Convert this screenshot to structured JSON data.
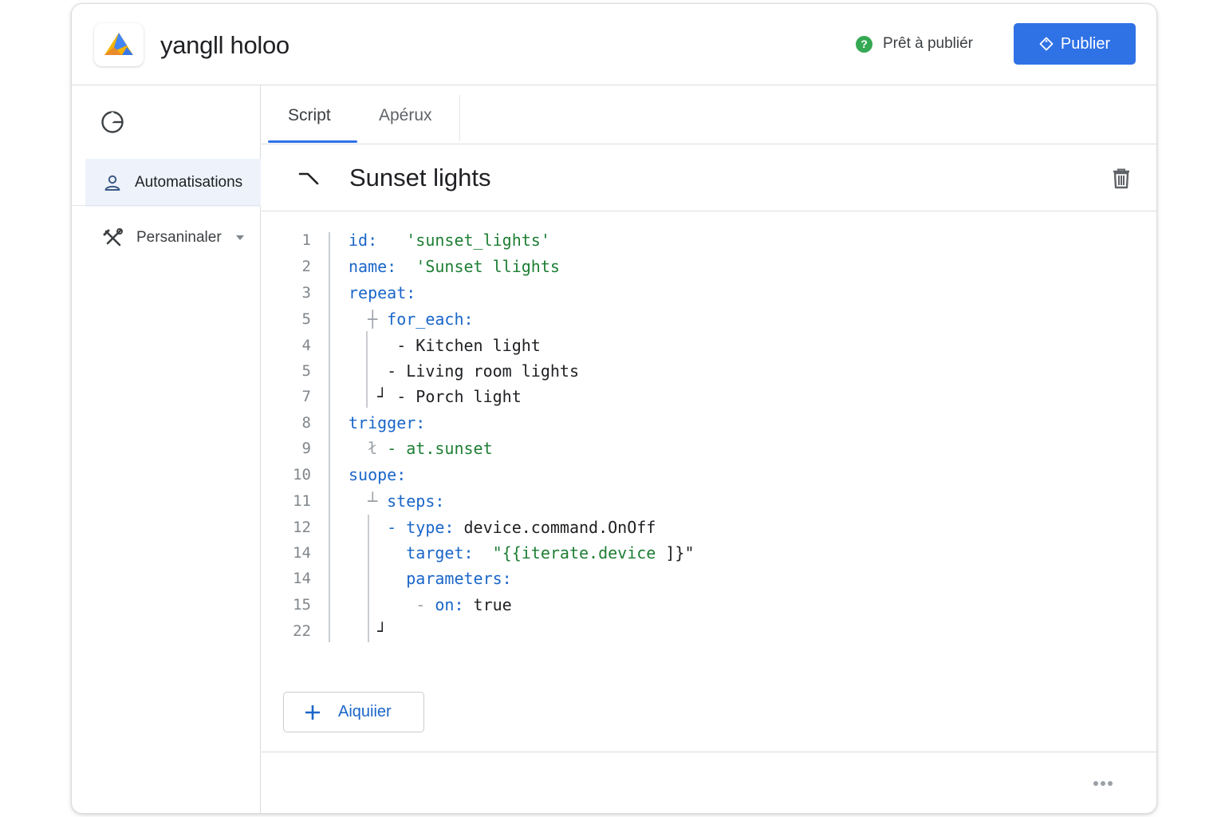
{
  "header": {
    "app_title": "yangll holoo",
    "status_text": "Prêt à publiér",
    "status_icon": "?",
    "publish_label": "Publier"
  },
  "sidebar": {
    "items": [
      {
        "label": "Automatisations",
        "icon": "person-icon",
        "active": true
      },
      {
        "label": "Persaninaler",
        "icon": "tools-icon",
        "active": false
      }
    ]
  },
  "tabs": [
    {
      "label": "Script",
      "active": true
    },
    {
      "label": "Apérux",
      "active": false
    }
  ],
  "script": {
    "title": "Sunset lights",
    "lines": [
      {
        "n": "1",
        "parts": [
          [
            "k",
            "id:"
          ],
          [
            "p",
            "   "
          ],
          [
            "s",
            "'sunset_lights'"
          ]
        ]
      },
      {
        "n": "2",
        "parts": [
          [
            "k",
            "name:"
          ],
          [
            "p",
            "  "
          ],
          [
            "s",
            "'Sunset llights"
          ]
        ]
      },
      {
        "n": "3",
        "parts": [
          [
            "k",
            "repeat:"
          ]
        ]
      },
      {
        "n": "5",
        "parts": [
          [
            "g",
            "  ┼ "
          ],
          [
            "k",
            "for_each:"
          ]
        ]
      },
      {
        "n": "4",
        "parts": [
          [
            "p",
            "     - Kitchen light"
          ]
        ]
      },
      {
        "n": "5",
        "parts": [
          [
            "p",
            "    - Living room lights"
          ]
        ]
      },
      {
        "n": "7",
        "parts": [
          [
            "p",
            "   ┘ - Porch light"
          ]
        ]
      },
      {
        "n": "8",
        "parts": [
          [
            "k",
            "trigger:"
          ]
        ]
      },
      {
        "n": "9",
        "parts": [
          [
            "g",
            "  ł "
          ],
          [
            "s",
            "- at.sunset"
          ]
        ]
      },
      {
        "n": "10",
        "parts": [
          [
            "k",
            "suope:"
          ]
        ]
      },
      {
        "n": "11",
        "parts": [
          [
            "g",
            "  ┴ "
          ],
          [
            "k",
            "steps:"
          ]
        ]
      },
      {
        "n": "12",
        "parts": [
          [
            "p",
            "    "
          ],
          [
            "k",
            "- type:"
          ],
          [
            "p",
            " device.command.OnOff"
          ]
        ]
      },
      {
        "n": "14",
        "parts": [
          [
            "p",
            "      "
          ],
          [
            "k",
            "target:"
          ],
          [
            "p",
            "  "
          ],
          [
            "s",
            "\"{{iterate.device "
          ],
          [
            "p",
            "]}\""
          ]
        ]
      },
      {
        "n": "14",
        "parts": [
          [
            "p",
            "      "
          ],
          [
            "k",
            "parameters:"
          ]
        ]
      },
      {
        "n": "15",
        "parts": [
          [
            "p",
            "       "
          ],
          [
            "g",
            "- "
          ],
          [
            "k",
            "on:"
          ],
          [
            "p",
            " true"
          ]
        ]
      },
      {
        "n": "22",
        "parts": [
          [
            "p",
            "   ┘"
          ]
        ]
      }
    ]
  },
  "add_button": {
    "label": "Aiquiier"
  },
  "colors": {
    "accent": "#2f72e6",
    "keyword": "#1a66c9",
    "string": "#1e7e34",
    "status_ok": "#34a853"
  }
}
